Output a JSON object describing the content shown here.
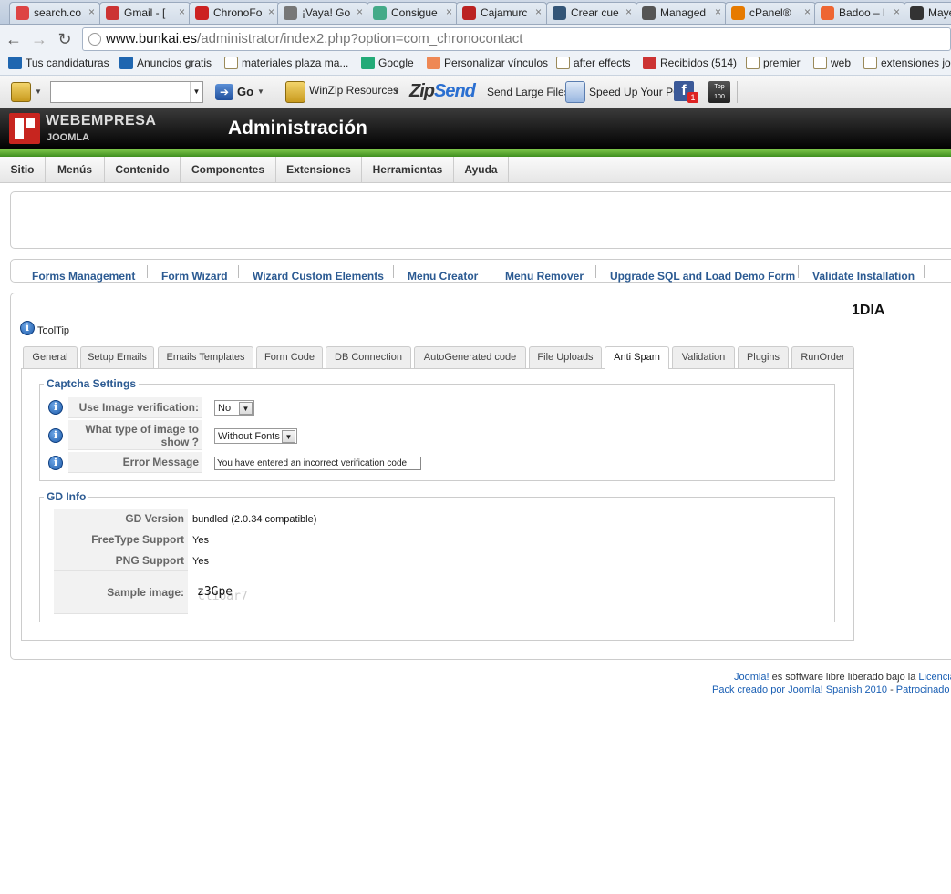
{
  "browser": {
    "tabs": [
      {
        "label": "search.co",
        "icon": "search-icon",
        "color": "#d44"
      },
      {
        "label": "Gmail - [",
        "icon": "gmail-icon",
        "color": "#c33"
      },
      {
        "label": "ChronoFo",
        "icon": "chronoforms-icon",
        "color": "#c22"
      },
      {
        "label": "¡Vaya! Go",
        "icon": "globe-icon",
        "color": "#777"
      },
      {
        "label": "Consigue",
        "icon": "chrome-icon",
        "color": "#4a8"
      },
      {
        "label": "Cajamurc",
        "icon": "bank-icon",
        "color": "#b22"
      },
      {
        "label": "Crear cue",
        "icon": "wordpress-icon",
        "color": "#357"
      },
      {
        "label": "Managed",
        "icon": "loading-icon",
        "color": "#555"
      },
      {
        "label": "cPanel®",
        "icon": "cpanel-icon",
        "color": "#e67a00"
      },
      {
        "label": "Badoo – l",
        "icon": "badoo-icon",
        "color": "#e63"
      },
      {
        "label": "Maye",
        "icon": "joomla-icon",
        "color": "#333"
      }
    ],
    "url_domain": "www.bunkai.es",
    "url_path": "/administrator/index2.php?option=com_chronocontact",
    "bookmarks": [
      {
        "label": "Tus candidaturas",
        "icon": "infojobs-icon"
      },
      {
        "label": "Anuncios gratis",
        "icon": "anuncios-icon"
      },
      {
        "label": "materiales plaza ma...",
        "icon": "folder-icon"
      },
      {
        "label": "Google",
        "icon": "google-icon"
      },
      {
        "label": "Personalizar vínculos",
        "icon": "windows-icon"
      },
      {
        "label": "after effects",
        "icon": "folder-icon"
      },
      {
        "label": "Recibidos (514)",
        "icon": "gmail-icon"
      },
      {
        "label": "premier",
        "icon": "folder-icon"
      },
      {
        "label": "web",
        "icon": "folder-icon"
      },
      {
        "label": "extensiones joo",
        "icon": "folder-icon"
      }
    ],
    "toolbar": {
      "go_label": "Go",
      "winzip_label": "WinZip Resources",
      "zipsend_zip": "Zip",
      "zipsend_send": "Send",
      "send_large": "Send Large Files",
      "speedup": "Speed Up Your PC",
      "fb_badge": "1",
      "top100": "Top 100"
    }
  },
  "joomla": {
    "logo_top": "WEBEMPRESA",
    "logo_bottom": "JOOMLA",
    "header_title": "Administración",
    "menu": [
      "Sitio",
      "Menús",
      "Contenido",
      "Componentes",
      "Extensiones",
      "Herramientas",
      "Ayuda"
    ],
    "submenu": [
      "Forms Management",
      "Form Wizard",
      "Wizard Custom Elements",
      "Menu Creator",
      "Menu Remover",
      "Upgrade SQL and Load Demo Form",
      "Validate Installation"
    ],
    "form_name": "1DIA",
    "tooltip_label": "ToolTip",
    "tabs": [
      "General",
      "Setup Emails",
      "Emails Templates",
      "Form Code",
      "DB Connection",
      "AutoGenerated code",
      "File Uploads",
      "Anti Spam",
      "Validation",
      "Plugins",
      "RunOrder"
    ],
    "active_tab": "Anti Spam",
    "captcha": {
      "legend": "Captcha Settings",
      "use_image_label": "Use Image verification:",
      "use_image_value": "No",
      "image_type_label_1": "What type of image to",
      "image_type_label_2": "show ?",
      "image_type_value": "Without Fonts",
      "error_label": "Error Message",
      "error_value": "You have entered an incorrect verification code"
    },
    "gd": {
      "legend": "GD Info",
      "version_label": "GD Version",
      "version_value": "bundled (2.0.34 compatible)",
      "freetype_label": "FreeType Support",
      "freetype_value": "Yes",
      "png_label": "PNG Support",
      "png_value": "Yes",
      "sample_label": "Sample image:",
      "sample_text": "z3Gpe",
      "sample_shadow": "clioar7"
    },
    "footer": {
      "line1_link": "Joomla!",
      "line1_text": " es software libre liberado bajo la ",
      "line1_link2": "Licencia",
      "line2_link": "Pack creado por Joomla! Spanish 2010",
      "line2_sep": " - ",
      "line2_link2": "Patrocinado p"
    }
  }
}
